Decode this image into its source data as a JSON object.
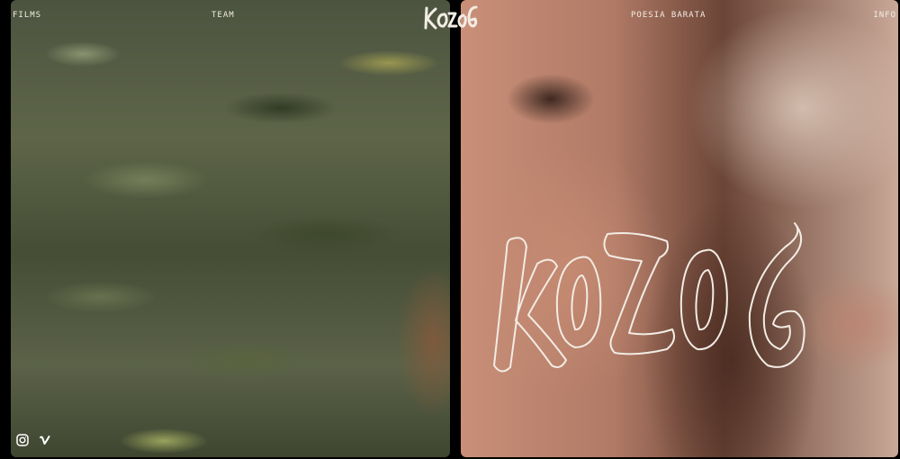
{
  "nav": {
    "films": "FILMS",
    "team": "TEAM",
    "poesia": "POESIA BARATA",
    "info": "INFO"
  },
  "brand": {
    "logo_text": "KOZOG",
    "hero_text": "KOZOG",
    "color": "#f2ece4"
  },
  "social": {
    "instagram_icon": "instagram-icon",
    "vimeo_icon": "vimeo-icon"
  }
}
